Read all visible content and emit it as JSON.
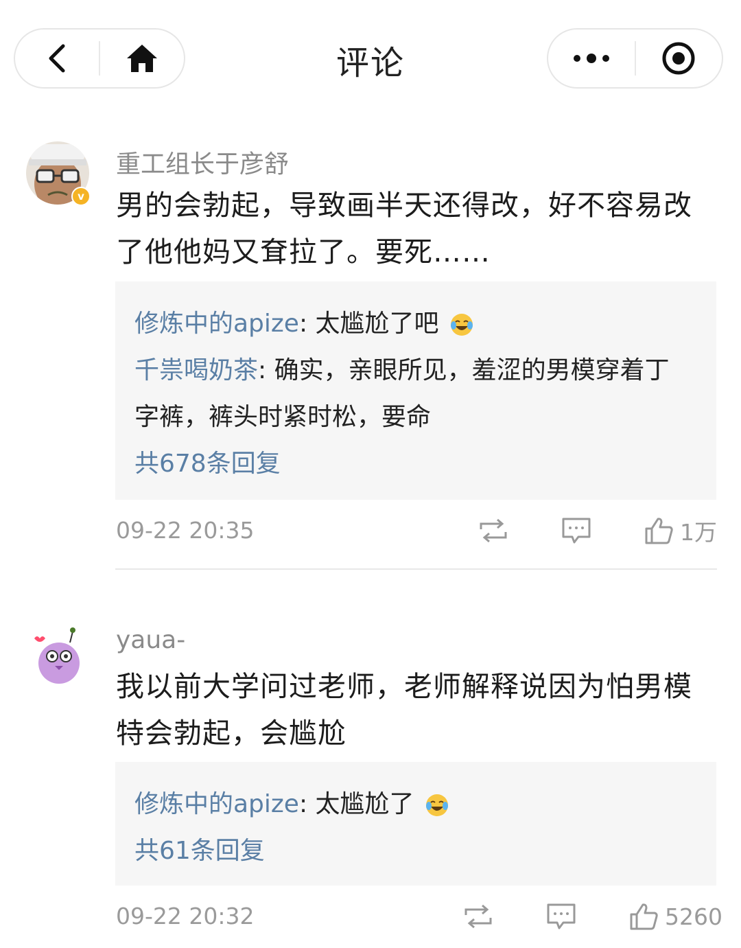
{
  "nav": {
    "title": "评论",
    "back_icon": "chevron-left-icon",
    "home_icon": "home-icon",
    "more_icon": "more-dots-icon",
    "close_icon": "target-icon"
  },
  "comments": [
    {
      "username": "重工组长于彦舒",
      "text": "男的会勃起，导致画半天还得改，好不容易改了他他妈又耷拉了。要死……",
      "replies": [
        {
          "name": "修炼中的apize",
          "sep": ": ",
          "text": "太尴尬了吧"
        },
        {
          "name": "千祟喝奶茶",
          "sep": ": ",
          "text": "确实，亲眼所见，羞涩的男模穿着丁字裤，裤头时紧时松，要命"
        }
      ],
      "reply_count": "共678条回复",
      "time": "09-22 20:35",
      "likes": "1万"
    },
    {
      "username": "yaua-",
      "text": "我以前大学问过老师，老师解释说因为怕男模特会勃起，会尴尬",
      "replies": [
        {
          "name": "修炼中的apize",
          "sep": ": ",
          "text": "太尴尬了"
        }
      ],
      "reply_count": "共61条回复",
      "time": "09-22 20:32",
      "likes": "5260"
    }
  ]
}
